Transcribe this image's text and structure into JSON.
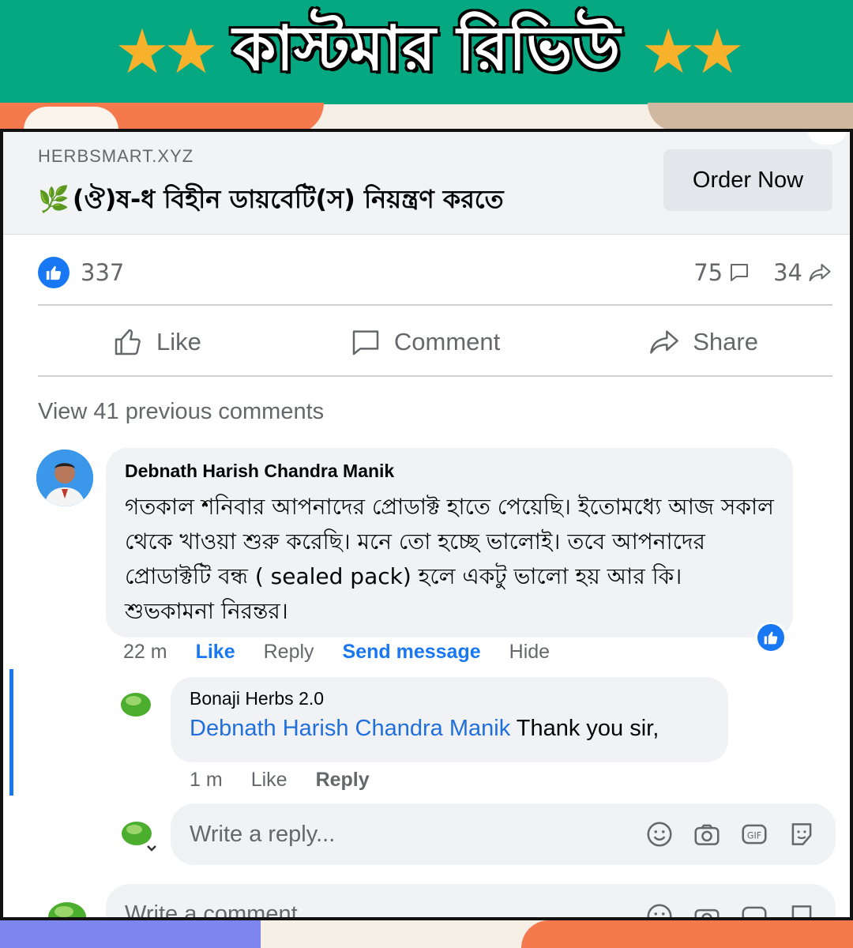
{
  "banner": {
    "title": "কাস্টমার রিভিউ",
    "stars_left": "★★",
    "stars_right": "★★"
  },
  "ad": {
    "domain": "HERBSMART.XYZ",
    "headline": "(ঔ)ষ-ধ বিহীন ডায়বেটি(স) নিয়ন্ত্রণ করতে",
    "cta": "Order Now"
  },
  "stats": {
    "likes": "337",
    "comments": "75",
    "shares": "34"
  },
  "actions": {
    "like": "Like",
    "comment": "Comment",
    "share": "Share"
  },
  "view_previous": "View 41 previous comments",
  "comment": {
    "author": "Debnath Harish Chandra Manik",
    "text": "গতকাল শনিবার আপনাদের প্রোডাক্ট হাতে পেয়েছি। ইতোমধ্যে আজ সকাল থেকে খাওয়া শুরু করেছি। মনে তো হচ্ছে ভালোই। তবে আপনাদের প্রোডাক্টটি বন্ধ ( sealed pack) হলে একটু ভালো হয় আর কি। শুভকামনা নিরন্তর।",
    "time": "22 m",
    "like": "Like",
    "reply": "Reply",
    "send_message": "Send message",
    "hide": "Hide"
  },
  "reply": {
    "author": "Bonaji Herbs 2.0",
    "mention": "Debnath Harish Chandra Manik",
    "text": " Thank you sir,",
    "time": "1 m",
    "like": "Like",
    "reply": "Reply"
  },
  "reply_input": {
    "placeholder": "Write a reply..."
  },
  "comment_input": {
    "placeholder": "Write a comment..."
  },
  "colors": {
    "banner": "#05a881",
    "star": "#f7b12a",
    "facebook_blue": "#1877f2"
  }
}
